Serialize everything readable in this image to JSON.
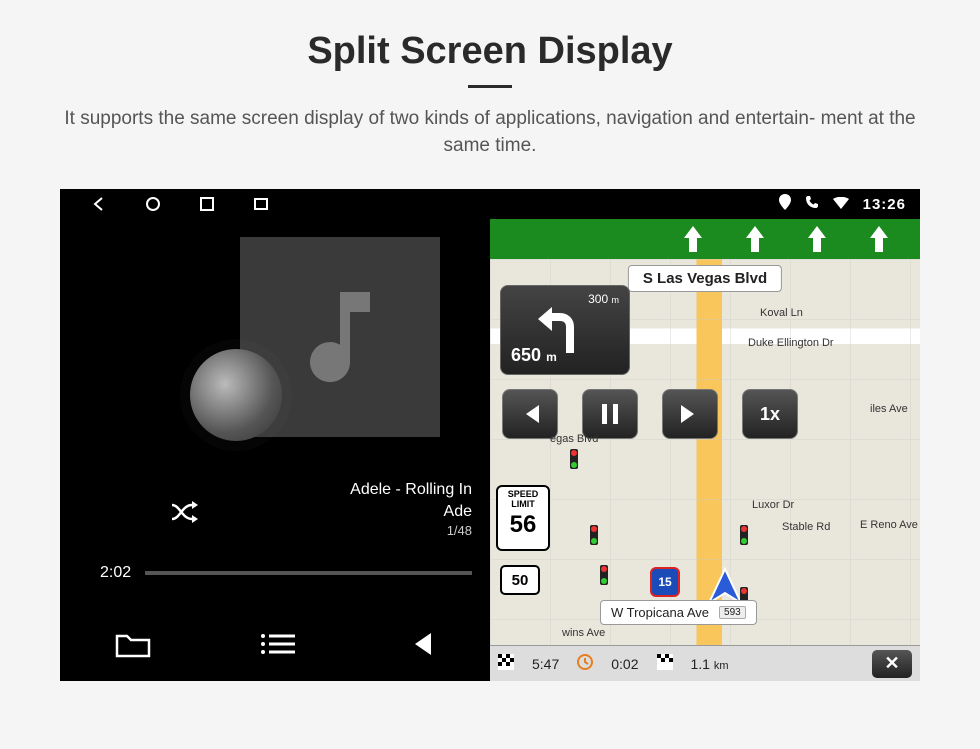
{
  "page": {
    "title": "Split Screen Display",
    "subtitle": "It supports the same screen display of two kinds of applications, navigation and entertain-\nment at the same time."
  },
  "status": {
    "time": "13:26"
  },
  "music": {
    "track_line1": "Adele - Rolling In",
    "track_line2": "Ade",
    "track_index": "1/48",
    "elapsed": "2:02"
  },
  "nav": {
    "top_street": "S Las Vegas Blvd",
    "turn_next_distance_small": "300",
    "turn_next_unit_small": "m",
    "turn_main_distance": "650",
    "turn_main_unit": "m",
    "playback_speed": "1x",
    "speed_limit_label1": "SPEED",
    "speed_limit_label2": "LIMIT",
    "speed_limit_value": "56",
    "route_shield": "50",
    "interstate": "15",
    "bottom_street": "W Tropicana Ave",
    "bottom_street_tag": "593",
    "eta": "5:47",
    "time_remaining": "0:02",
    "distance_remaining": "1.1",
    "distance_unit": "km",
    "road_labels": {
      "koval": "Koval Ln",
      "duke": "Duke Ellington Dr",
      "iles": "iles Ave",
      "egas": "egas Blvd",
      "luxor": "Luxor Dr",
      "stable": "Stable Rd",
      "reno": "E Reno Ave",
      "wins": "wins Ave"
    }
  }
}
